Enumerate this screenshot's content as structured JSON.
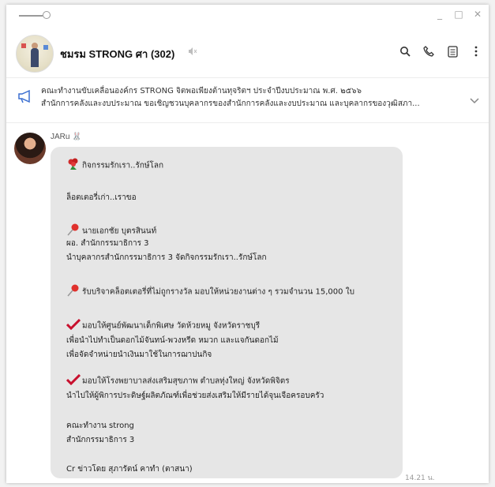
{
  "window": {
    "controls": [
      "_",
      "□",
      "✕"
    ]
  },
  "header": {
    "group_name": "ชมรม STRONG ศา (302)",
    "icons": [
      "search-icon",
      "phone-icon",
      "notes-icon",
      "more-icon"
    ]
  },
  "announcement": {
    "line1": "คณะทำงานขับเคลื่อนองค์กร STRONG จิตพอเพียงต้านทุจริตฯ ประจำปีงบประมาณ พ.ศ. ๒๕๖๖",
    "line2": "สำนักการคลังและงบประมาณ ขอเชิญชวนบุคลากรของสำนักการคลังและงบประมาณ และบุคลากรของวุฒิสภา..."
  },
  "message": {
    "sender": "JARu",
    "lines": [
      "กิจกรรมรักเรา..รักษ์โลก",
      "ล็อตเตอรี่เก่า..เราขอ",
      "นายเอกชัย บุตรสินนท์",
      "ผอ. สำนักกรรมาธิการ 3",
      "นำบุคลากรสำนักกรรมาธิการ 3 จัดกิจกรรมรักเรา..รักษ์โลก",
      "รับบริจาคล็อตเตอรี่ที่ไม่ถูกรางวัล มอบให้หน่วยงานต่าง ๆ รวมจำนวน 15,000 ใบ",
      "มอบให้ศูนย์พัฒนาเด็กพิเศษ วัดห้วยหมู จังหวัดราชบุรี",
      "เพื่อนำไปทำเป็นดอกไม้จันทน์-พวงหรีด หมวก และแจกันดอกไม้",
      "เพื่อจัดจำหน่ายนำเงินมาใช้ในการฌาปนกิจ",
      "มอบให้โรงพยาบาลส่งเสริมสุขภาพ ตำบลทุ่งใหญ่ จังหวัดพิจิตร",
      "นำไปให้ผู้พิการประดิษฐ์ผลิตภัณฑ์เพื่อช่วยส่งเสริมให้มีรายได้จุนเจือครอบครัว",
      "คณะทำงาน strong",
      "สำนักกรรมาธิการ 3",
      "Cr ข่าวโดย สุภารัตน์ คาทำ (ตาสนา)"
    ],
    "time": "14.21 น.",
    "colors": {
      "bubble": "#e6e6e6",
      "check": "#c8102e",
      "pin": "#e0312d"
    }
  }
}
